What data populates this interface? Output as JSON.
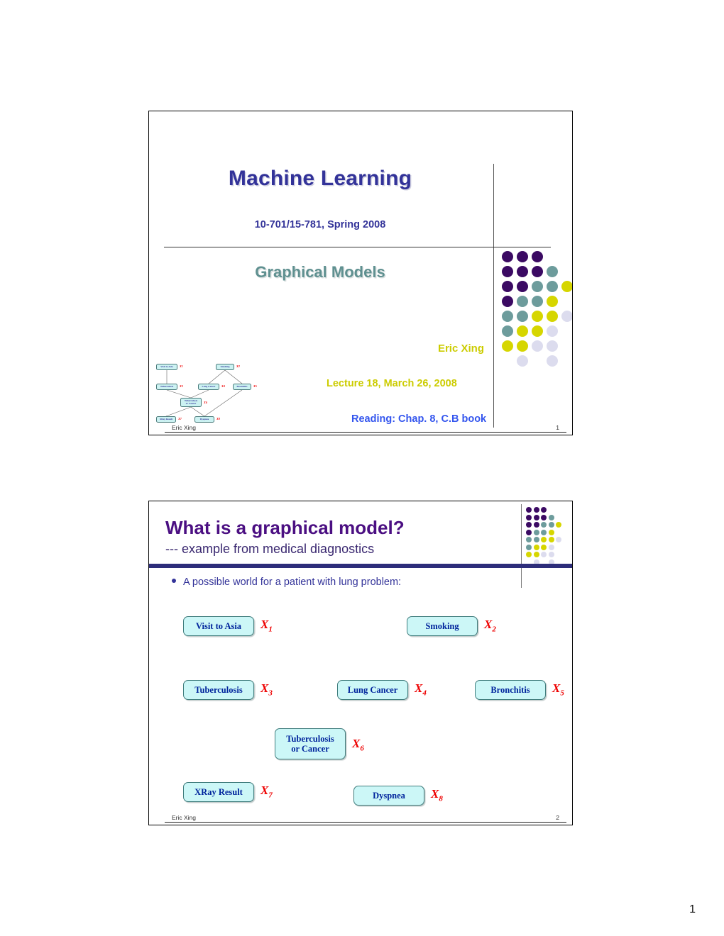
{
  "document": {
    "page_number": "1"
  },
  "colors": {
    "dot_dark_purple": "#3B0A63",
    "dot_teal": "#6D9C9C",
    "dot_yellow": "#D6D600",
    "dot_lavender": "#DCDCEE",
    "title_blue": "#333399",
    "course_teal": "#5F9090",
    "author_yellow": "#CCCC00",
    "reading_blue": "#3355EE",
    "slide2_title_purple": "#4B0F82",
    "slide2_bar": "#2D2D7A",
    "node_fill": "#CCF7F7",
    "node_border": "#3F7C7C",
    "node_text": "#00249C",
    "variable_red": "#EE0000"
  },
  "slide1": {
    "title": "Machine Learning",
    "subtitle": "10-701/15-781, Spring 2008",
    "course_topic": "Graphical Models",
    "author": "Eric Xing",
    "lecture": "Lecture 18, March 26, 2008",
    "reading": "Reading: Chap. 8, C.B book",
    "footer_name": "Eric Xing",
    "footer_number": "1",
    "mini_diagram": {
      "nodes": [
        {
          "label": "Visit to Asia",
          "var": "X1"
        },
        {
          "label": "Smoking",
          "var": "X2"
        },
        {
          "label": "Tuberculosis",
          "var": "X3"
        },
        {
          "label": "Lung Cancer",
          "var": "X4"
        },
        {
          "label": "Bronchitis",
          "var": "X5"
        },
        {
          "label": "Tuberculosis\nor Cancer",
          "var": "X6"
        },
        {
          "label": "XRay Result",
          "var": "X7"
        },
        {
          "label": "Dyspnea",
          "var": "X8"
        }
      ]
    }
  },
  "slide2": {
    "title": "What is a graphical model?",
    "subtitle": "--- example from medical diagnostics",
    "bullet": "A possible world for a patient with lung problem:",
    "footer_name": "Eric Xing",
    "footer_number": "2",
    "nodes": [
      {
        "label": "Visit to Asia",
        "var_base": "X",
        "var_sub": "1"
      },
      {
        "label": "Smoking",
        "var_base": "X",
        "var_sub": "2"
      },
      {
        "label": "Tuberculosis",
        "var_base": "X",
        "var_sub": "3"
      },
      {
        "label": "Lung Cancer",
        "var_base": "X",
        "var_sub": "4"
      },
      {
        "label": "Bronchitis",
        "var_base": "X",
        "var_sub": "5"
      },
      {
        "label": "Tuberculosis\nor Cancer",
        "var_base": "X",
        "var_sub": "6"
      },
      {
        "label": "XRay Result",
        "var_base": "X",
        "var_sub": "7"
      },
      {
        "label": "Dyspnea",
        "var_base": "X",
        "var_sub": "8"
      }
    ]
  },
  "dot_pattern": {
    "description": "7-row triangular halftone grid of 5 columns",
    "rows": [
      [
        "purple",
        "purple",
        "purple",
        null,
        null
      ],
      [
        "purple",
        "purple",
        "purple",
        "teal",
        null
      ],
      [
        "purple",
        "purple",
        "teal",
        "teal",
        "yellow"
      ],
      [
        "purple",
        "teal",
        "teal",
        "yellow",
        null
      ],
      [
        "teal",
        "teal",
        "yellow",
        "yellow",
        "lavender"
      ],
      [
        "teal",
        "yellow",
        "yellow",
        "lavender",
        null
      ],
      [
        "yellow",
        "yellow",
        "lavender",
        "lavender",
        null
      ],
      [
        null,
        "lavender",
        null,
        "lavender",
        null
      ]
    ]
  }
}
